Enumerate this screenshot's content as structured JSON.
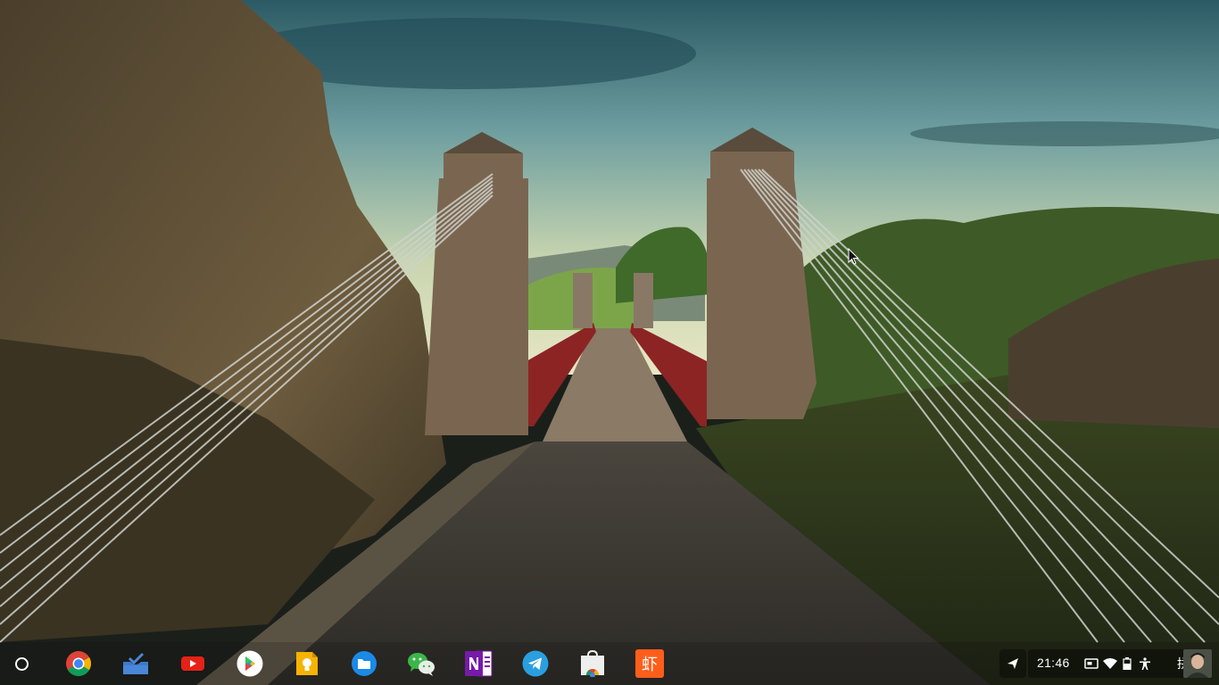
{
  "desktop": {
    "wallpaper_icon": "landscape-wallpaper"
  },
  "shelf": {
    "launcher_icon": "launcher-circle-icon",
    "apps": [
      {
        "icon": "chrome-icon"
      },
      {
        "icon": "inbox-icon"
      },
      {
        "icon": "youtube-icon"
      },
      {
        "icon": "play-store-icon"
      },
      {
        "icon": "google-keep-icon"
      },
      {
        "icon": "files-icon"
      },
      {
        "icon": "wechat-icon"
      },
      {
        "icon": "onenote-icon"
      },
      {
        "icon": "telegram-icon"
      },
      {
        "icon": "chrome-web-store-icon"
      },
      {
        "icon": "xiami-music-icon",
        "text": "虾"
      }
    ]
  },
  "tray": {
    "send_icon": "send-arrow-icon",
    "time": "21:46",
    "ime_label": "拼",
    "icons": [
      "screen-cast-icon",
      "wifi-icon",
      "battery-icon",
      "accessibility-icon",
      "avatar-icon"
    ]
  },
  "colors": {
    "chrome_red": "#db4437",
    "chrome_green": "#0f9d58",
    "chrome_yellow": "#f4b400",
    "chrome_blue": "#4285f4",
    "youtube_red": "#e62117",
    "keep_yellow": "#f6b300",
    "files_blue": "#1a8ae8",
    "wechat_green": "#3bb74a",
    "onenote_purple": "#7719aa",
    "telegram_blue": "#2a9fe0",
    "xiami_orange": "#ff5e1a"
  }
}
